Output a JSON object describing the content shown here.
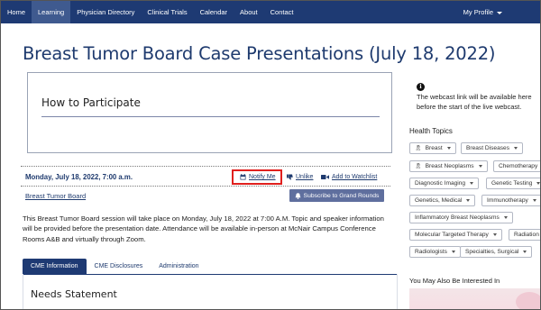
{
  "nav": {
    "items": [
      "Home",
      "Learning",
      "Physician Directory",
      "Clinical Trials",
      "Calendar",
      "About",
      "Contact"
    ],
    "active": "Learning",
    "profile": "My Profile"
  },
  "page": {
    "title": "Breast Tumor Board Case Presentations (July 18, 2022)"
  },
  "participate": {
    "heading": "How to Participate"
  },
  "session": {
    "date": "Monday, July 18, 2022, 7:00 a.m.",
    "notify": "Notify Me",
    "unlike": "Unlike",
    "watchlist": "Add to Watchlist",
    "link": "Breast Tumor Board",
    "subscribe": "Subscribe to Grand Rounds",
    "description": "This Breast Tumor Board session will take place on Monday, July 18, 2022 at 7:00 A.M. Topic and speaker information will be provided before the presentation date. Attendance will be available in-person at McNair Campus Conference Rooms A&B and virtually through Zoom."
  },
  "tabs": [
    "CME Information",
    "CME Disclosures",
    "Administration"
  ],
  "active_tab": "CME Information",
  "cme": {
    "heading": "Needs Statement"
  },
  "sidebar": {
    "info_icon": "i",
    "webcast_line1": "The webcast link will be available here",
    "webcast_line2": "before the start of the live webcast.",
    "health_title": "Health Topics",
    "tags": [
      {
        "label": "Breast",
        "icon": "ribbon-icon"
      },
      {
        "label": "Breast Diseases",
        "icon": ""
      },
      {
        "label": "Breast Neoplasms",
        "icon": "ribbon-icon"
      },
      {
        "label": "Chemotherapy",
        "icon": ""
      },
      {
        "label": "Diagnostic Imaging",
        "icon": ""
      },
      {
        "label": "Genetic Testing",
        "icon": ""
      },
      {
        "label": "Genetics, Medical",
        "icon": ""
      },
      {
        "label": "Immunotherapy",
        "icon": ""
      },
      {
        "label": "Inflammatory Breast Neoplasms",
        "icon": ""
      },
      {
        "label": "Molecular Targeted Therapy",
        "icon": ""
      },
      {
        "label": "Radiation",
        "icon": ""
      },
      {
        "label": "Radiologists",
        "icon": ""
      },
      {
        "label": "Specialties, Surgical",
        "icon": ""
      }
    ],
    "may_also": "You May Also Be Interested In"
  },
  "colors": {
    "nav_bg": "#1e3a73",
    "accent": "#1e3a6e",
    "highlight_box": "#e0201e",
    "subscribe_bg": "#5f6f9e"
  }
}
